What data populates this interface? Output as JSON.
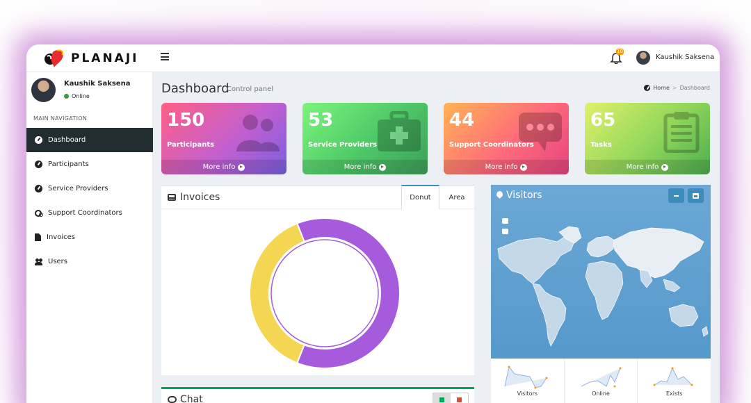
{
  "app": {
    "logo_text": "PLANAJI"
  },
  "topbar": {
    "notification_count": "10",
    "user_name": "Kaushik Saksena"
  },
  "sidebar": {
    "user_name": "Kaushik Saksena",
    "status": "Online",
    "nav_header": "MAIN NAVIGATION",
    "items": [
      {
        "label": "Dashboard",
        "icon": "dashboard-icon",
        "active": true
      },
      {
        "label": "Participants",
        "icon": "dashboard-icon"
      },
      {
        "label": "Service Providers",
        "icon": "dashboard-icon"
      },
      {
        "label": "Support Coordinators",
        "icon": "gears-icon"
      },
      {
        "label": "Invoices",
        "icon": "file-icon"
      },
      {
        "label": "Users",
        "icon": "users-icon"
      }
    ]
  },
  "page": {
    "title": "Dashboard",
    "subtitle": "Control panel",
    "breadcrumb": {
      "home": "Home",
      "current": "Dashboard"
    }
  },
  "tiles": [
    {
      "value": "150",
      "label": "Participants",
      "footer": "More info",
      "icon": "users-icon"
    },
    {
      "value": "53",
      "label": "Service Providers",
      "footer": "More info",
      "icon": "medkit-icon"
    },
    {
      "value": "44",
      "label": "Support Coordinators",
      "footer": "More info",
      "icon": "chat-bubble-icon"
    },
    {
      "value": "65",
      "label": "Tasks",
      "footer": "More info",
      "icon": "clipboard-icon"
    }
  ],
  "invoices": {
    "title": "Invoices",
    "tabs": [
      "Donut",
      "Area"
    ],
    "active_tab": "Donut",
    "donut": {
      "segments": [
        {
          "share": 0.62,
          "color": "#a55bdc"
        },
        {
          "share": 0.38,
          "color": "#f5d652"
        }
      ]
    }
  },
  "chat": {
    "title": "Chat"
  },
  "visitors": {
    "title": "Visitors",
    "sparklines": [
      {
        "label": "Visitors"
      },
      {
        "label": "Online"
      },
      {
        "label": "Exists"
      }
    ]
  }
}
